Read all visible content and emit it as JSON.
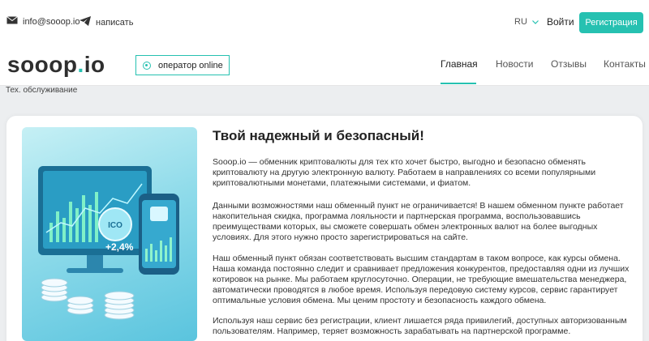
{
  "topbar": {
    "email": "info@sooop.io",
    "write_label": "написать",
    "language": "RU",
    "login_label": "Войти",
    "register_label": "Регистрация"
  },
  "header": {
    "logo_main": "sooop",
    "logo_dot": ".",
    "logo_tld": "io",
    "operator_status": "оператор online",
    "nav": [
      "Главная",
      "Новости",
      "Отзывы",
      "Контакты"
    ]
  },
  "maintenance_label": "Тех. обслуживание",
  "hero_image": {
    "icon": "crypto-exchange-illustration",
    "badge_text": "ICO",
    "percent_text": "+2,4%"
  },
  "content": {
    "title": "Твой надежный и безопасный!",
    "paragraphs": [
      "Sooop.io — обменник криптовалюты для тех кто хочет быстро, выгодно и безопасно обменять криптовалюту на другую электронную валюту. Работаем в направлениях со всеми популярными криптовалютными монетами, платежными системами, и фиатом.",
      "Данными возможностями наш обменный пункт не ограничивается! В нашем обменном пункте работает накопительная скидка, программа лояльности и партнерская программа, воспользовавшись преимуществами которых, вы сможете совершать обмен электронных валют на более выгодных условиях. Для этого нужно просто зарегистрироваться на сайте.",
      "Наш обменный пункт обязан соответствовать высшим стандартам в таком вопросе, как курсы обмена. Наша команда постоянно следит и сравнивает предложения конкурентов, предоставляя одни из лучших котировок на рынке. Мы работаем круглосуточно. Операции, не требующие вмешательства менеджера, автоматически проводятся в любое время. Используя передовую систему курсов, сервис гарантирует оптимальные условия обмена. Мы ценим простоту и безопасность каждого обмена.",
      "Используя наш сервис без регистрации, клиент лишается ряда привилегий, доступных авторизованным пользователям. Например, теряет возможность зарабатывать на партнерской программе."
    ]
  },
  "colors": {
    "accent": "#26c1b1",
    "text": "#222222",
    "background": "#eceef0"
  }
}
